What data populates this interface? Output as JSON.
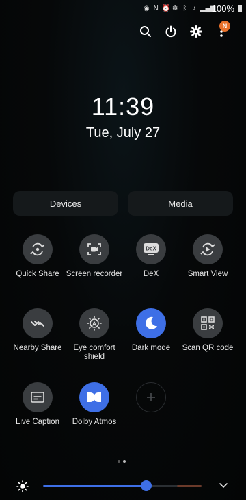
{
  "status_bar": {
    "icons": [
      "eye-icon",
      "nfc-icon",
      "alarm-icon",
      "settings-icon",
      "bluetooth-icon",
      "mute-icon",
      "signal-icon"
    ],
    "battery": "100%"
  },
  "top_actions": {
    "icons": [
      "search-icon",
      "power-icon",
      "gear-icon",
      "more-icon"
    ],
    "notification_badge": "N"
  },
  "clock": {
    "time": "11:39",
    "date": "Tue, July 27"
  },
  "pills": {
    "devices": "Devices",
    "media": "Media"
  },
  "tiles": [
    {
      "label": "Quick Share",
      "icon": "quick-share-icon",
      "state": "off"
    },
    {
      "label": "Screen recorder",
      "icon": "screen-recorder-icon",
      "state": "off"
    },
    {
      "label": "DeX",
      "icon": "dex-icon",
      "state": "off"
    },
    {
      "label": "Smart View",
      "icon": "smart-view-icon",
      "state": "off"
    },
    {
      "label": "Nearby Share",
      "icon": "nearby-share-icon",
      "state": "off"
    },
    {
      "label": "Eye comfort shield",
      "icon": "eye-comfort-icon",
      "state": "off"
    },
    {
      "label": "Dark mode",
      "icon": "moon-icon",
      "state": "on"
    },
    {
      "label": "Scan QR code",
      "icon": "qr-code-icon",
      "state": "off"
    },
    {
      "label": "Live Caption",
      "icon": "caption-icon",
      "state": "off"
    },
    {
      "label": "Dolby Atmos",
      "icon": "dolby-icon",
      "state": "on"
    },
    {
      "label": "",
      "icon": "add-icon",
      "state": "add"
    }
  ],
  "page_indicator": {
    "count": 2,
    "active": 2
  },
  "brightness": {
    "level": 0.65
  },
  "colors": {
    "accent": "#3e6fe6",
    "tile_off": "#3a3d40",
    "badge": "#e8712a"
  }
}
